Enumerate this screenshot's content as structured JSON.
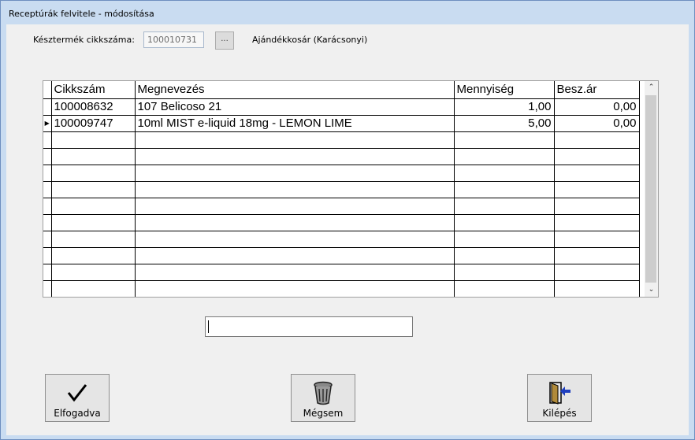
{
  "window": {
    "title": "Receptúrák felvitele - módosítása"
  },
  "header": {
    "product_code_label": "Késztermék cikkszáma:",
    "product_code_value": "100010731",
    "browse_label": "...",
    "product_name": "Ajándékkosár (Karácsonyi)"
  },
  "grid": {
    "columns": [
      "Cikkszám",
      "Megnevezés",
      "Mennyiség",
      "Besz.ár"
    ],
    "rows": [
      [
        "100008632",
        "107 Belicoso 21",
        "1,00",
        "0,00"
      ],
      [
        "100009747",
        "10ml MIST e-liquid 18mg - LEMON LIME",
        "5,00",
        "0,00"
      ]
    ],
    "current_row_marker": "▶",
    "scroll_up": "⌃",
    "scroll_down": "⌄"
  },
  "entry": {
    "value": ""
  },
  "buttons": {
    "accept": "Elfogadva",
    "cancel": "Mégsem",
    "exit": "Kilépés"
  },
  "icons": {
    "accept": "checkmark-icon",
    "cancel": "trash-can-icon",
    "exit": "exit-door-icon"
  }
}
